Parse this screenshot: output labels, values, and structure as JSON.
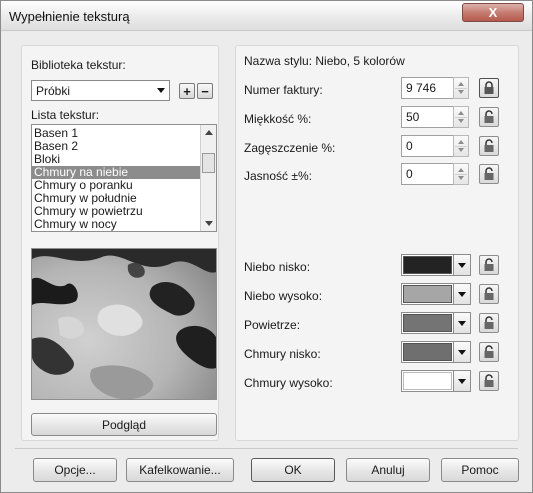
{
  "window": {
    "title": "Wypełnienie teksturą",
    "close_label": "X"
  },
  "left": {
    "library_label": "Biblioteka tekstur:",
    "library_value": "Próbki",
    "add_icon": "+",
    "remove_icon": "−",
    "list_label": "Lista tekstur:",
    "textures": [
      "Basen 1",
      "Basen 2",
      "Bloki",
      "Chmury na niebie",
      "Chmury o poranku",
      "Chmury w południe",
      "Chmury w powietrzu",
      "Chmury w nocy"
    ],
    "selected_index": 3,
    "preview_button": "Podgląd"
  },
  "right": {
    "style_name": "Nazwa stylu: Niebo, 5 kolorów",
    "numeric": [
      {
        "label": "Numer faktury:",
        "value": "9 746"
      },
      {
        "label": "Miękkość %:",
        "value": "50"
      },
      {
        "label": "Zagęszczenie %:",
        "value": "0"
      },
      {
        "label": "Jasność ±%:",
        "value": "0"
      }
    ],
    "colors": [
      {
        "label": "Niebo nisko:",
        "color": "#232323"
      },
      {
        "label": "Niebo wysoko:",
        "color": "#a6a6a6"
      },
      {
        "label": "Powietrze:",
        "color": "#747474"
      },
      {
        "label": "Chmury nisko:",
        "color": "#6f6f6f"
      },
      {
        "label": "Chmury wysoko:",
        "color": "#ffffff"
      }
    ]
  },
  "footer": {
    "options": "Opcje...",
    "tiling": "Kafelkowanie...",
    "ok": "OK",
    "cancel": "Anuluj",
    "help": "Pomoc"
  },
  "icons": {
    "lock": "lock-icon",
    "dropdown": "chevron-down-icon",
    "spinner": "spinner-arrows-icon"
  }
}
